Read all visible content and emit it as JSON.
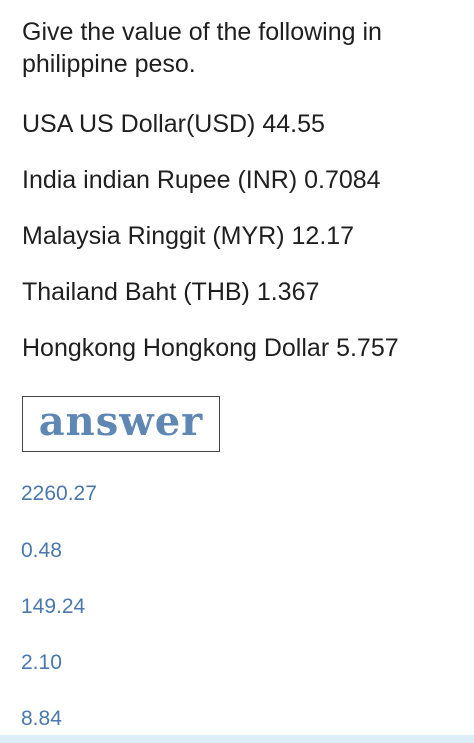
{
  "question": {
    "text": "Give the value of the following in philippine peso."
  },
  "items": [
    "USA US Dollar(USD) 44.55",
    "India indian Rupee (INR) 0.7084",
    "Malaysia Ringgit (MYR) 12.17",
    "Thailand Baht (THB) 1.367",
    "Hongkong Hongkong Dollar 5.757"
  ],
  "answer_heading": "answer",
  "answers": [
    "2260.27",
    "0.48",
    "149.24",
    "2.10",
    "8.84"
  ],
  "colors": {
    "text": "#1f1f1f",
    "answer_blue": "#4a78ab",
    "heading_blue": "#5e87b3",
    "bottom_bar": "#dceef8"
  }
}
